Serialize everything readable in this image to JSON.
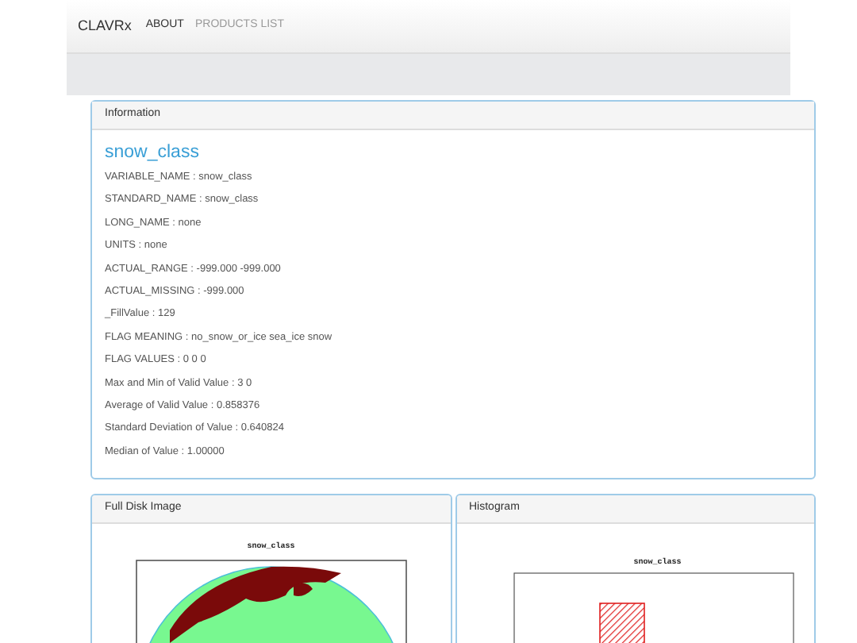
{
  "navbar": {
    "brand": "CLAVRx",
    "links": [
      {
        "label": "ABOUT",
        "selected": true
      },
      {
        "label": "PRODUCTS LIST",
        "selected": false
      }
    ]
  },
  "information": {
    "heading": "Information",
    "title": "snow_class",
    "lines": [
      "VARIABLE_NAME : snow_class",
      "STANDARD_NAME : snow_class",
      "LONG_NAME : none",
      "UNITS : none",
      "ACTUAL_RANGE : -999.000 -999.000",
      "ACTUAL_MISSING : -999.000",
      "_FillValue : 129",
      "FLAG MEANING : no_snow_or_ice sea_ice snow",
      "FLAG VALUES : 0 0 0",
      "Max and Min of Valid Value : 3 0",
      "Average of Valid Value : 0.858376",
      "Standard Deviation of Value : 0.640824",
      "Median of Value : 1.00000"
    ]
  },
  "panels": [
    {
      "heading": "Full Disk Image",
      "kind": "map",
      "plot_title": "snow_class"
    },
    {
      "heading": "Histogram",
      "kind": "histogram",
      "plot_title": "snow_class"
    }
  ]
}
